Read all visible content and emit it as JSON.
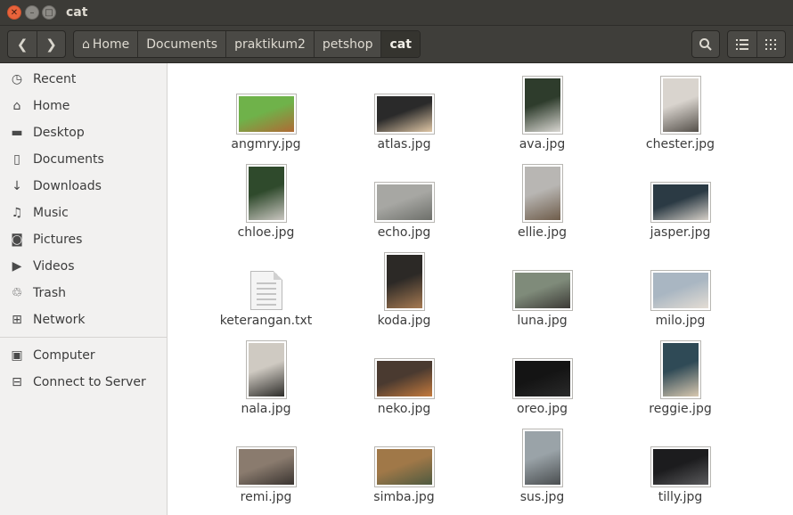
{
  "window": {
    "title": "cat"
  },
  "breadcrumbs": [
    "Home",
    "Documents",
    "praktikum2",
    "petshop",
    "cat"
  ],
  "sidebar": {
    "places": [
      {
        "label": "Recent",
        "icon": "clock-icon"
      },
      {
        "label": "Home",
        "icon": "home-icon"
      },
      {
        "label": "Desktop",
        "icon": "folder-icon"
      },
      {
        "label": "Documents",
        "icon": "document-icon"
      },
      {
        "label": "Downloads",
        "icon": "download-icon"
      },
      {
        "label": "Music",
        "icon": "music-icon"
      },
      {
        "label": "Pictures",
        "icon": "camera-icon"
      },
      {
        "label": "Videos",
        "icon": "video-icon"
      },
      {
        "label": "Trash",
        "icon": "trash-icon"
      },
      {
        "label": "Network",
        "icon": "network-icon"
      }
    ],
    "devices": [
      {
        "label": "Computer",
        "icon": "computer-icon"
      },
      {
        "label": "Connect to Server",
        "icon": "server-icon"
      }
    ]
  },
  "files": [
    {
      "name": "angmry.jpg",
      "orient": "land",
      "colors": [
        "#6fb24a",
        "#b06a34"
      ]
    },
    {
      "name": "atlas.jpg",
      "orient": "land",
      "colors": [
        "#2a2a2a",
        "#e0c7a6"
      ]
    },
    {
      "name": "ava.jpg",
      "orient": "port",
      "colors": [
        "#2e3c2c",
        "#d9d7d2"
      ]
    },
    {
      "name": "chester.jpg",
      "orient": "port",
      "colors": [
        "#d9d4ce",
        "#55504a"
      ]
    },
    {
      "name": "chloe.jpg",
      "orient": "port",
      "colors": [
        "#2f4a2c",
        "#c9c6c0"
      ]
    },
    {
      "name": "echo.jpg",
      "orient": "land",
      "colors": [
        "#a7a7a3",
        "#6d6f6a"
      ]
    },
    {
      "name": "ellie.jpg",
      "orient": "port",
      "colors": [
        "#b8b6b3",
        "#6e5c4a"
      ]
    },
    {
      "name": "jasper.jpg",
      "orient": "land",
      "colors": [
        "#2b3a44",
        "#d6d0c8"
      ]
    },
    {
      "name": "keterangan.txt",
      "orient": "txt",
      "colors": [
        "#f4f4f4",
        "#c4c4c4"
      ]
    },
    {
      "name": "koda.jpg",
      "orient": "port",
      "colors": [
        "#2c2926",
        "#a67a52"
      ]
    },
    {
      "name": "luna.jpg",
      "orient": "land",
      "colors": [
        "#7f8b7a",
        "#3c3a36"
      ]
    },
    {
      "name": "milo.jpg",
      "orient": "land",
      "colors": [
        "#a9b6c2",
        "#e4ddd4"
      ]
    },
    {
      "name": "nala.jpg",
      "orient": "port",
      "colors": [
        "#cfcac2",
        "#2e2d2a"
      ]
    },
    {
      "name": "neko.jpg",
      "orient": "land",
      "colors": [
        "#4a3a30",
        "#c47a3d"
      ]
    },
    {
      "name": "oreo.jpg",
      "orient": "land",
      "colors": [
        "#141414",
        "#2a2a2a"
      ]
    },
    {
      "name": "reggie.jpg",
      "orient": "port",
      "colors": [
        "#2f4a56",
        "#d8c8b0"
      ]
    },
    {
      "name": "remi.jpg",
      "orient": "land",
      "colors": [
        "#8a7b6e",
        "#3a3430"
      ]
    },
    {
      "name": "simba.jpg",
      "orient": "land",
      "colors": [
        "#a07848",
        "#4e5a40"
      ]
    },
    {
      "name": "sus.jpg",
      "orient": "port",
      "colors": [
        "#9aa3a8",
        "#4a4e50"
      ]
    },
    {
      "name": "tilly.jpg",
      "orient": "land",
      "colors": [
        "#1c1c1e",
        "#5a5a5c"
      ]
    }
  ]
}
